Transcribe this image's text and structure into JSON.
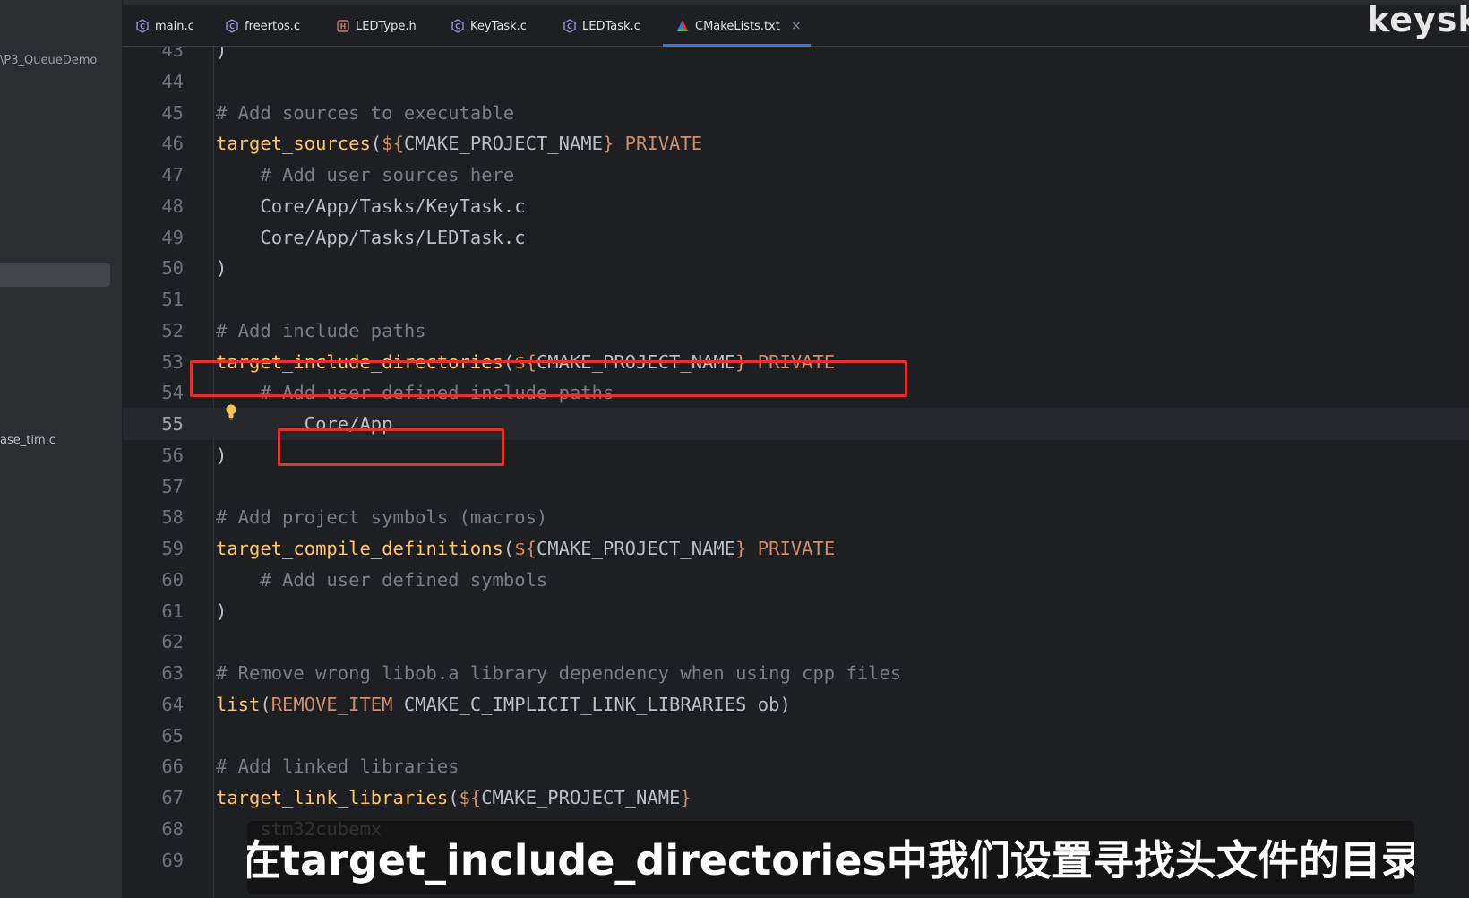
{
  "sidebar": {
    "project_path": "\\P3_QueueDemo",
    "file_label": "ase_tim.c"
  },
  "tabs": [
    {
      "label": "main.c",
      "icon": "c-file-icon"
    },
    {
      "label": "freertos.c",
      "icon": "c-file-icon"
    },
    {
      "label": "LEDType.h",
      "icon": "h-file-icon"
    },
    {
      "label": "KeyTask.c",
      "icon": "c-file-icon"
    },
    {
      "label": "LEDTask.c",
      "icon": "c-file-icon"
    },
    {
      "label": "CMakeLists.txt",
      "icon": "cmake-icon",
      "active": true,
      "close": "×"
    }
  ],
  "brand": "keyski",
  "colors": {
    "background": "#1e1f22",
    "accent": "#3574f0",
    "highlight_box": "#e3312f",
    "comment": "#7a7e85",
    "function": "#ffc66d",
    "keyword": "#cf8e6d"
  },
  "editor": {
    "current_line": "55",
    "lines": [
      {
        "n": "43",
        "tokens": [
          {
            "t": ")",
            "c": "pl"
          }
        ]
      },
      {
        "n": "44",
        "tokens": []
      },
      {
        "n": "45",
        "tokens": [
          {
            "t": "# Add sources to executable",
            "c": "cm"
          }
        ]
      },
      {
        "n": "46",
        "tokens": [
          {
            "t": "target_sources",
            "c": "fn"
          },
          {
            "t": "(",
            "c": "pl"
          },
          {
            "t": "${",
            "c": "kw"
          },
          {
            "t": "CMAKE_PROJECT_NAME",
            "c": "pl"
          },
          {
            "t": "}",
            "c": "kw"
          },
          {
            "t": " PRIVATE",
            "c": "kw"
          }
        ]
      },
      {
        "n": "47",
        "tokens": [
          {
            "t": "    # Add user sources here",
            "c": "cm"
          }
        ]
      },
      {
        "n": "48",
        "tokens": [
          {
            "t": "    Core/App/Tasks/KeyTask.c",
            "c": "pl"
          }
        ]
      },
      {
        "n": "49",
        "tokens": [
          {
            "t": "    Core/App/Tasks/LEDTask.c",
            "c": "pl"
          }
        ]
      },
      {
        "n": "50",
        "tokens": [
          {
            "t": ")",
            "c": "pl"
          }
        ]
      },
      {
        "n": "51",
        "tokens": []
      },
      {
        "n": "52",
        "tokens": [
          {
            "t": "# Add include paths",
            "c": "cm"
          }
        ]
      },
      {
        "n": "53",
        "tokens": [
          {
            "t": "target_include_directories",
            "c": "fn"
          },
          {
            "t": "(",
            "c": "pl"
          },
          {
            "t": "${",
            "c": "kw"
          },
          {
            "t": "CMAKE_PROJECT_NAME",
            "c": "pl"
          },
          {
            "t": "}",
            "c": "kw"
          },
          {
            "t": " PRIVATE",
            "c": "kw"
          }
        ]
      },
      {
        "n": "54",
        "tokens": [
          {
            "t": "    # Add user defined include paths",
            "c": "cm"
          }
        ]
      },
      {
        "n": "55",
        "tokens": [
          {
            "t": "        Core/App",
            "c": "pl"
          }
        ]
      },
      {
        "n": "56",
        "tokens": [
          {
            "t": ")",
            "c": "pl"
          }
        ]
      },
      {
        "n": "57",
        "tokens": []
      },
      {
        "n": "58",
        "tokens": [
          {
            "t": "# Add project symbols (macros)",
            "c": "cm"
          }
        ]
      },
      {
        "n": "59",
        "tokens": [
          {
            "t": "target_compile_definitions",
            "c": "fn"
          },
          {
            "t": "(",
            "c": "pl"
          },
          {
            "t": "${",
            "c": "kw"
          },
          {
            "t": "CMAKE_PROJECT_NAME",
            "c": "pl"
          },
          {
            "t": "}",
            "c": "kw"
          },
          {
            "t": " PRIVATE",
            "c": "kw"
          }
        ]
      },
      {
        "n": "60",
        "tokens": [
          {
            "t": "    # Add user defined symbols",
            "c": "cm"
          }
        ]
      },
      {
        "n": "61",
        "tokens": [
          {
            "t": ")",
            "c": "pl"
          }
        ]
      },
      {
        "n": "62",
        "tokens": []
      },
      {
        "n": "63",
        "tokens": [
          {
            "t": "# Remove wrong libob.a library dependency when using cpp files",
            "c": "cm"
          }
        ]
      },
      {
        "n": "64",
        "tokens": [
          {
            "t": "list",
            "c": "fn"
          },
          {
            "t": "(",
            "c": "pl"
          },
          {
            "t": "REMOVE_ITEM",
            "c": "kw"
          },
          {
            "t": " CMAKE_C_IMPLICIT_LINK_LIBRARIES ob)",
            "c": "pl"
          }
        ]
      },
      {
        "n": "65",
        "tokens": []
      },
      {
        "n": "66",
        "tokens": [
          {
            "t": "# Add linked libraries",
            "c": "cm"
          }
        ]
      },
      {
        "n": "67",
        "tokens": [
          {
            "t": "target_link_libraries",
            "c": "fn"
          },
          {
            "t": "(",
            "c": "pl"
          },
          {
            "t": "${",
            "c": "kw"
          },
          {
            "t": "CMAKE_PROJECT_NAME",
            "c": "pl"
          },
          {
            "t": "}",
            "c": "kw"
          }
        ]
      },
      {
        "n": "68",
        "tokens": [
          {
            "t": "    stm32cubemx",
            "c": "pl"
          }
        ]
      },
      {
        "n": "69",
        "tokens": []
      }
    ]
  },
  "subtitle": "在target_include_directories中我们设置寻找头文件的目录"
}
